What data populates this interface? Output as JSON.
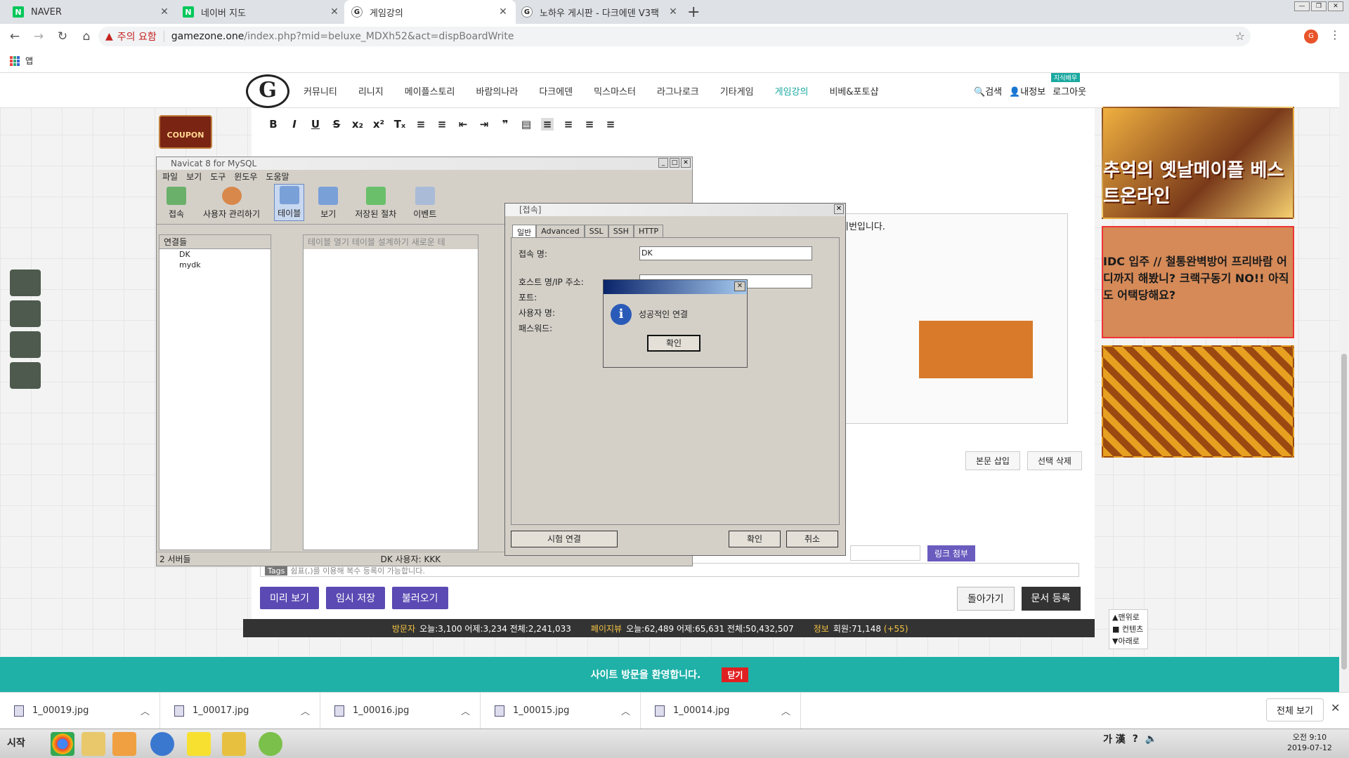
{
  "browser": {
    "tabs": [
      {
        "title": "NAVER",
        "favicon": "N"
      },
      {
        "title": "네이버 지도",
        "favicon": "N"
      },
      {
        "title": "게임강의",
        "favicon": "G"
      },
      {
        "title": "노하우 게시판 - 다크에덴 V3팩",
        "favicon": "G"
      }
    ],
    "security_label": "주의 요함",
    "url_host": "gamezone.one",
    "url_path": "/index.php?mid=beluxe_MDXh52&act=dispBoardWrite",
    "bookmark_apps": "앱",
    "profile_initial": "G"
  },
  "site": {
    "logo_letter": "G",
    "menu": [
      "커뮤니티",
      "리니지",
      "메이플스토리",
      "바람의나라",
      "다크에덴",
      "믹스마스터",
      "라그나로크",
      "기타게임",
      "게임강의",
      "비베&포토샵"
    ],
    "search": "검색",
    "myinfo": "내정보",
    "logout": "로그아웃",
    "header_badge": "지식배우",
    "coupon": "COUPON",
    "editor_text": "비번입니다.",
    "insert_body": "본문 삽입",
    "delete_selected": "선택 삭제",
    "link_attach": "링크 첨부",
    "tags_label": "Tags",
    "tags_placeholder": "쉼표(,)를 이용해 복수 등록이 가능합니다.",
    "preview": "미리 보기",
    "temp_save": "임시 저장",
    "load": "불러오기",
    "back": "돌아가기",
    "register": "문서 등록",
    "stats": {
      "visitors_label": "방문자",
      "visitors": "오늘:3,100 어제:3,234 전체:2,241,033",
      "pageviews_label": "페이지뷰",
      "pageviews": "오늘:62,489 어제:65,631 전체:50,432,507",
      "info_label": "정보",
      "members": "회원:71,148",
      "members_delta": "(+55)"
    },
    "welcome": "사이트 방문을 환영합니다.",
    "welcome_close": "닫기",
    "scroll_top": "▲맨위로",
    "scroll_content": "■ 컨텐츠",
    "scroll_bottom": "▼아래로",
    "ads": [
      "추억의 옛날메이플 베스트온라인",
      "IDC 입주 // 철통완벽방어 프리바람 어디까지 해봤니? 크랙구동기 NO!! 아직도 어택당해요?",
      ""
    ]
  },
  "navicat": {
    "title": "Navicat 8 for MySQL",
    "menu": [
      "파일",
      "보기",
      "도구",
      "윈도우",
      "도움말"
    ],
    "tools": [
      "접속",
      "사용자 관리하기",
      "테이블",
      "보기",
      "저장된 절차",
      "이벤트"
    ],
    "connections_header": "연결들",
    "connections": [
      "DK",
      "mydk"
    ],
    "table_actions": "테이블 열기  테이블 설계하기  새로운 테",
    "status_servers": "2 서버들",
    "status_conn": "DK    사용자: KKK"
  },
  "conn_dialog": {
    "title": "[접속]",
    "tabs": [
      "일반",
      "Advanced",
      "SSL",
      "SSH",
      "HTTP"
    ],
    "conn_name_label": "접속 명:",
    "conn_name_value": "DK",
    "host_label": "호스트 명/IP 주소:",
    "port_label": "포트:",
    "user_label": "사용자 명:",
    "password_label": "패스워드:",
    "test_button": "시험 연결",
    "ok_button": "확인",
    "cancel_button": "취소"
  },
  "message_box": {
    "text": "성공적인 연결",
    "ok": "확인"
  },
  "downloads": [
    "1_00019.jpg",
    "1_00017.jpg",
    "1_00016.jpg",
    "1_00015.jpg",
    "1_00014.jpg"
  ],
  "download_show_all": "전체 보기",
  "taskbar": {
    "start": "시작",
    "ime": "가 漢",
    "time": "오전 9:10",
    "date": "2019-07-12"
  }
}
